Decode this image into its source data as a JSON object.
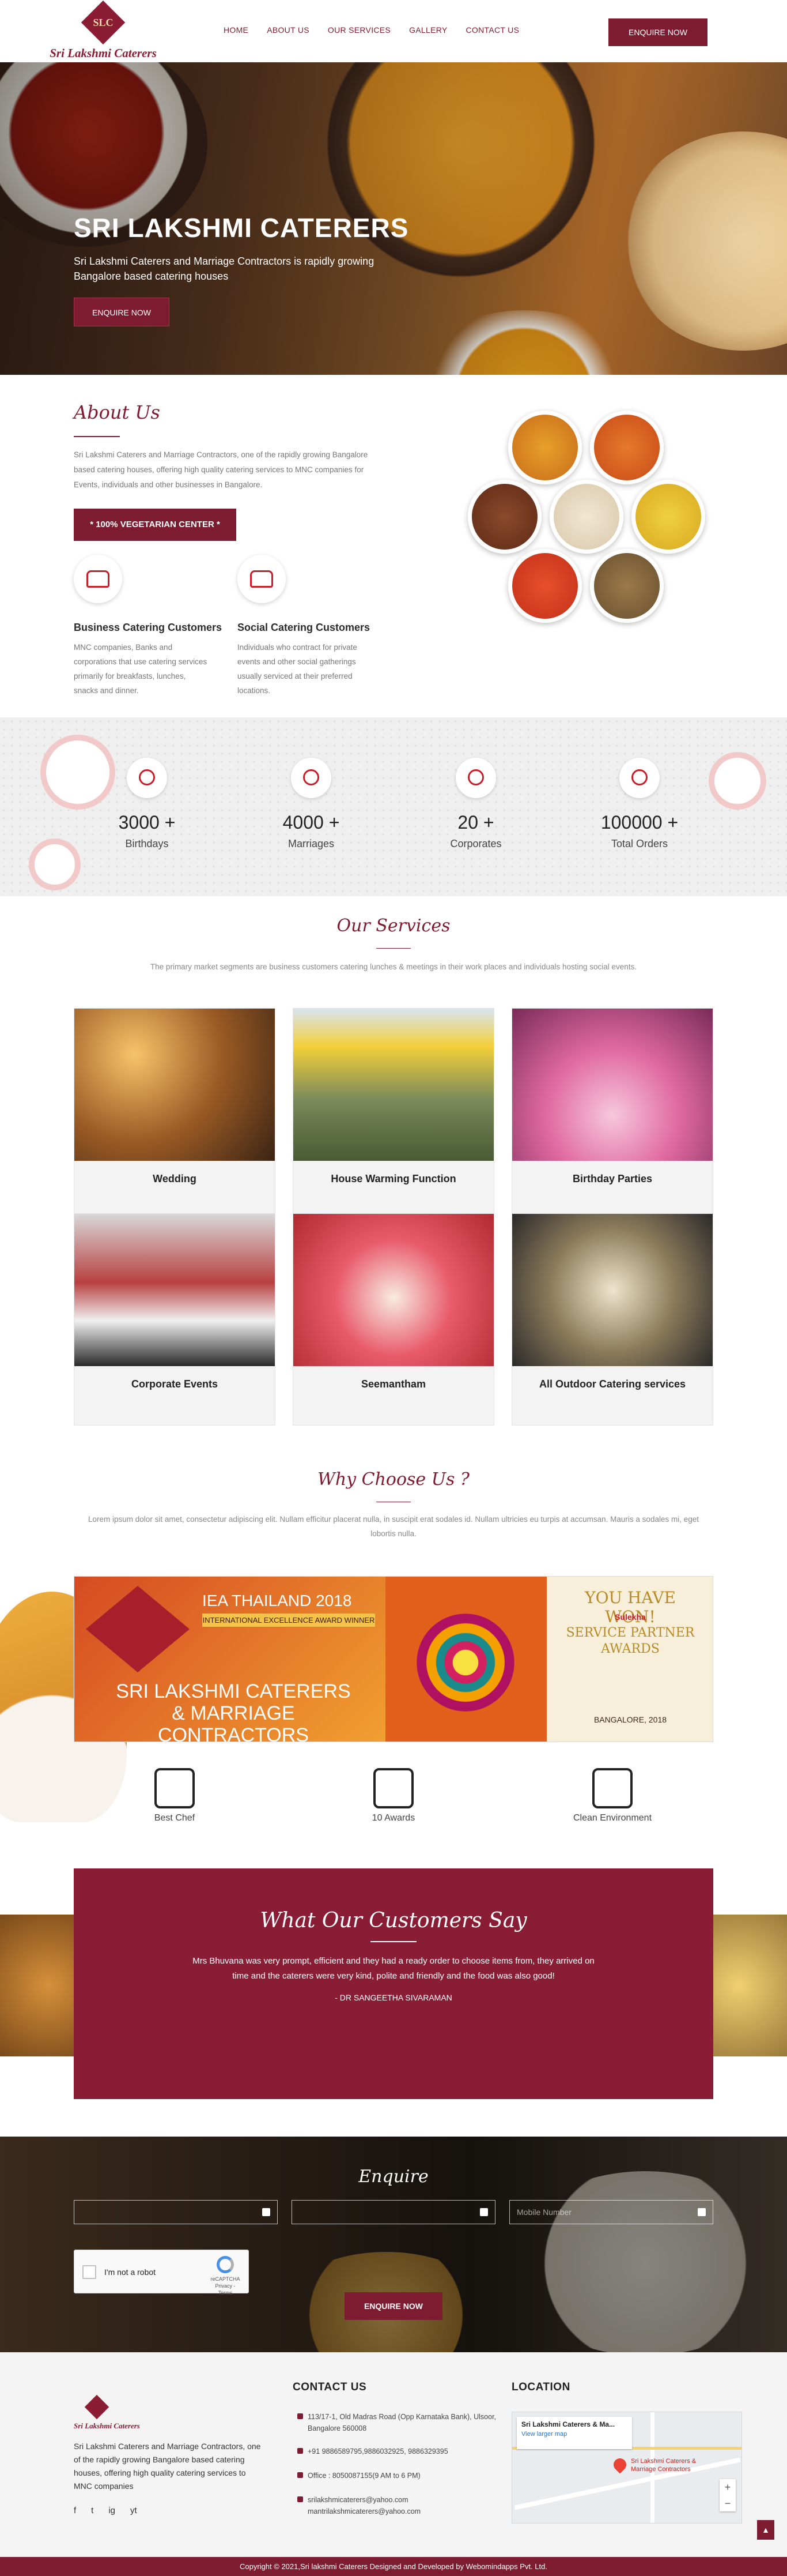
{
  "header": {
    "logo_mark": "SLC",
    "logo_text": "Sri Lakshmi Caterers",
    "nav": [
      "HOME",
      "ABOUT US",
      "OUR SERVICES",
      "GALLERY",
      "CONTACT US"
    ],
    "enquire_label": "ENQUIRE NOW"
  },
  "hero": {
    "title": "SRI LAKSHMI CATERERS",
    "subtitle": "Sri Lakshmi Caterers and Marriage Contractors is rapidly growing Bangalore based catering houses",
    "button": "ENQUIRE NOW"
  },
  "about": {
    "title": "About Us",
    "text": "Sri Lakshmi Caterers and Marriage Contractors, one of the rapidly growing Bangalore based catering houses, offering high quality catering services to MNC companies for Events, individuals and other businesses in Bangalore.",
    "veg_label": "* 100% VEGETARIAN CENTER *",
    "services": [
      {
        "title": "Business Catering Customers",
        "text": "MNC companies, Banks and corporations that use catering services primarily for breakfasts, lunches, snacks and dinner."
      },
      {
        "title": "Social Catering Customers",
        "text": "Individuals who contract for private events and other social gatherings usually serviced at their preferred locations."
      }
    ]
  },
  "stats": [
    {
      "value": "3000 +",
      "label": "Birthdays",
      "icon": "birthday-icon"
    },
    {
      "value": "4000 +",
      "label": "Marriages",
      "icon": "marriage-icon"
    },
    {
      "value": "20 +",
      "label": "Corporates",
      "icon": "corporate-icon"
    },
    {
      "value": "100000 +",
      "label": "Total Orders",
      "icon": "orders-icon"
    }
  ],
  "services": {
    "title": "Our Services",
    "subtitle": "The primary market segments are business customers catering lunches & meetings in their work places and individuals hosting social events.",
    "items": [
      "Wedding",
      "House Warming Function",
      "Birthday Parties",
      "Corporate Events",
      "Seemantham",
      "All Outdoor Catering services"
    ]
  },
  "why": {
    "title": "Why Choose Us ?",
    "subtitle": "Lorem ipsum dolor sit amet, consectetur adipiscing elit. Nullam efficitur placerat nulla, in suscipit erat sodales id. Nullam ultricies eu turpis at accumsan. Mauris a sodales mi, eget lobortis nulla.",
    "banner": {
      "iea_title": "IEA THAILAND 2018",
      "iea_sub": "INTERNATIONAL EXCELLENCE AWARD WINNER",
      "company": "SRI LAKSHMI CATERERS & MARRIAGE CONTRACTORS",
      "won": "YOU HAVE WON!",
      "brand": "Sulekha",
      "award": "SERVICE PARTNER AWARDS",
      "year": "BANGALORE, 2018"
    },
    "features": [
      "Best Chef",
      "10 Awards",
      "Clean Environment"
    ]
  },
  "testimonial": {
    "title": "What Our Customers Say",
    "text": "Mrs Bhuvana was very prompt, efficient and they had a ready order to choose items from, they arrived on time and the caterers were very kind, polite and friendly and the food was also good!",
    "author": "- DR SANGEETHA SIVARAMAN"
  },
  "enquire": {
    "title": "Enquire",
    "fields": [
      "",
      "",
      "Mobile Number"
    ],
    "captcha_label": "I'm not a robot",
    "captcha_brand": "reCAPTCHA",
    "captcha_links": "Privacy - Terms",
    "button": "ENQUIRE NOW"
  },
  "footer": {
    "logo_text": "Sri Lakshmi Caterers",
    "about": "Sri Lakshmi Caterers and Marriage Contractors, one of the rapidly growing Bangalore based catering houses, offering high quality catering services to MNC companies",
    "social": [
      "f",
      "t",
      "ig",
      "yt"
    ],
    "contact_title": "CONTACT US",
    "address": "113/17-1, Old Madras Road (Opp Karnataka Bank), Ulsoor, Bangalore 560008",
    "phone": "+91 9886589795,9886032925, 9886329395",
    "office": "Office : 8050087155(9 AM to 6 PM)",
    "email1": "srilakshmicaterers@yahoo.com",
    "email2": "mantrilakshmicaterers@yahoo.com",
    "location_title": "LOCATION",
    "map_place": "Sri Lakshmi Caterers & Ma...",
    "map_link": "View larger map",
    "map_pin": "Sri Lakshmi Caterers & Marriage Contractors",
    "copyright": "Copyright © 2021,Sri lakshmi Caterers Designed and Developed by Webomindapps Pvt. Ltd."
  }
}
